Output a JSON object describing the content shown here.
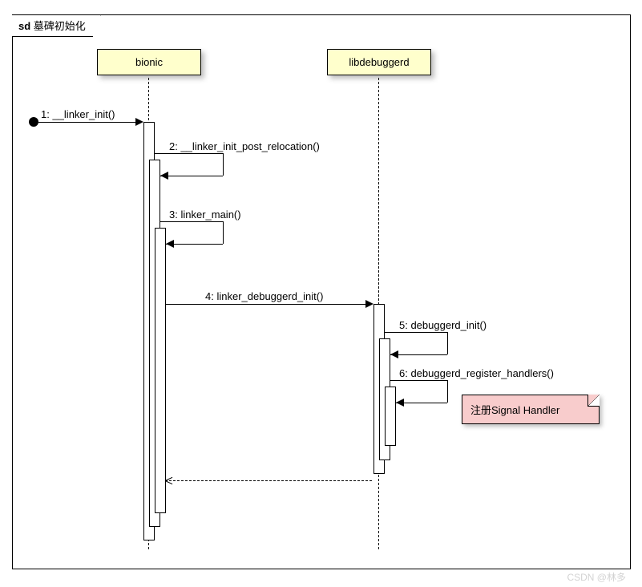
{
  "frame": {
    "prefix": "sd",
    "name": "墓碑初始化"
  },
  "lifelines": {
    "bionic": "bionic",
    "libdebuggerd": "libdebuggerd"
  },
  "messages": {
    "m1": "1: __linker_init()",
    "m2": "2: __linker_init_post_relocation()",
    "m3": "3: linker_main()",
    "m4": "4: linker_debuggerd_init()",
    "m5": "5: debuggerd_init()",
    "m6": "6: debuggerd_register_handlers()"
  },
  "note": "注册Signal Handler",
  "watermark": "CSDN @林多"
}
